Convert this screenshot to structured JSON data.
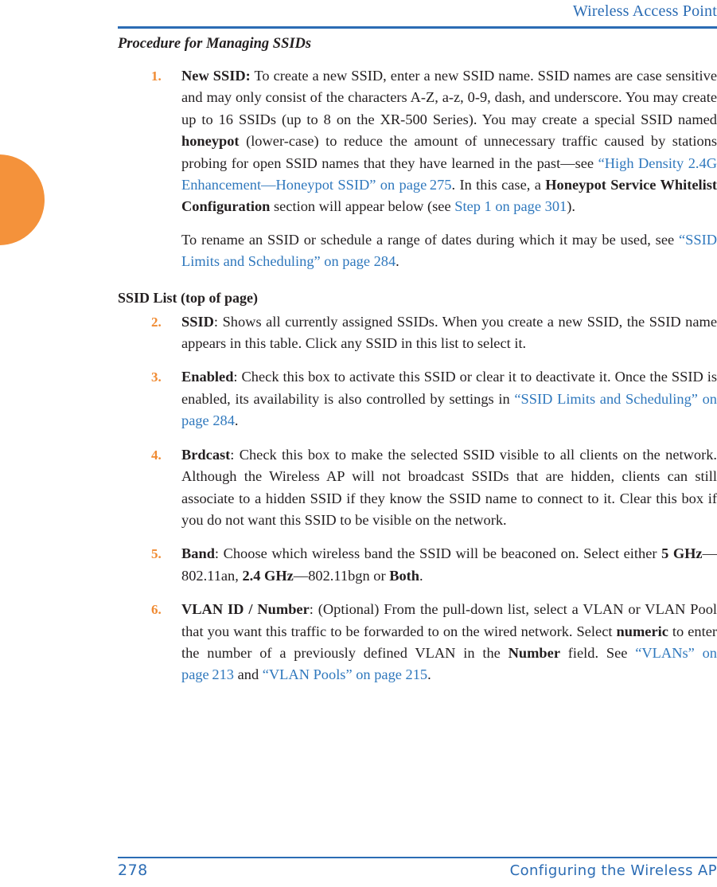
{
  "header": {
    "title": "Wireless Access Point",
    "rule_color": "#2b6cb4"
  },
  "decor": {
    "tab_color": "#f4923b",
    "tab_name": "orange-thumb-tab"
  },
  "content": {
    "section_heading": "Procedure for Managing SSIDs",
    "sub_heading": "SSID List (top of page)",
    "items": [
      {
        "number": "1.",
        "term": "New SSID:",
        "html": "<b>New SSID:</b> To create a new SSID, enter a new SSID name. SSID names are case sensitive and may only consist of the characters A-Z, a-z, 0-9, dash, and underscore. You may create up to 16 SSIDs (up to 8 on the XR-500 Series). You may create a special SSID named <b>honeypot</b> (lower-case) to reduce the amount of unnecessary traffic caused by stations probing for open SSID names that they have learned in the past—see <span class=\"lnk\">“High Density 2.4G Enhancement—Honeypot SSID” on page 275</span>. In this case, a <b>Honeypot Service Whitelist Configuration</b> section will appear below (see <span class=\"lnk\">Step 1 on page 301</span>)."
      },
      {
        "number": "2.",
        "term": "SSID",
        "html": "<b>SSID</b>: Shows all currently assigned SSIDs. When you create a new SSID, the SSID name appears in this table. Click any SSID in this list to select it."
      },
      {
        "number": "3.",
        "term": "Enabled",
        "html": "<b>Enabled</b>: Check this box to activate this SSID or clear it to deactivate it. Once the SSID is enabled, its availability is also controlled by settings in <span class=\"lnk\">“SSID Limits and Scheduling” on page 284</span>."
      },
      {
        "number": "4.",
        "term": "Brdcast",
        "html": "<b>Brdcast</b>: Check this box to make the selected SSID visible to all clients on the network. Although the Wireless AP will not broadcast SSIDs that are hidden, clients can still associate to a hidden SSID if they know the SSID name to connect to it. Clear this box if you do not want this SSID to be visible on the network."
      },
      {
        "number": "5.",
        "term": "Band",
        "html": "<b>Band</b>: Choose which wireless band the SSID will be beaconed on. Select either <b>5 GHz</b>—802.11an, <b>2.4 GHz</b>—802.11bgn or <b>Both</b>."
      },
      {
        "number": "6.",
        "term": "VLAN ID / Number",
        "html": "<b>VLAN ID / Number</b>: (Optional) From the pull-down list, select a VLAN or VLAN Pool that you want this traffic to be forwarded to on the wired network. Select <b>numeric</b> to enter the number of a previously defined VLAN in the <b>Number</b> field. See <span class=\"lnk\">“VLANs” on page 213</span> and <span class=\"lnk\">“VLAN Pools” on page 215</span>."
      }
    ],
    "rename_paragraph_html": "To rename an SSID or schedule a range of dates during which it may be used, see <span class=\"lnk\">“SSID Limits and Scheduling” on page 284</span>."
  },
  "footer": {
    "page_number": "278",
    "title": "Configuring the Wireless AP",
    "rule_color": "#2b6cb4"
  }
}
